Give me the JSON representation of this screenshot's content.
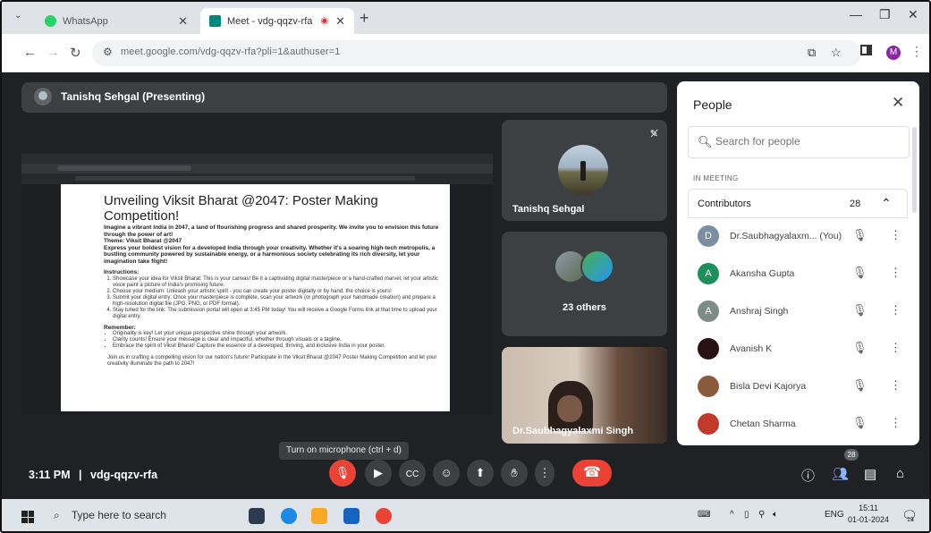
{
  "browser": {
    "tabs": [
      {
        "title": "WhatsApp",
        "active": false
      },
      {
        "title": "Meet - vdg-qqzv-rfa",
        "active": true
      }
    ],
    "url": "meet.google.com/vdg-qqzv-rfa?pli=1&authuser=1",
    "profile_initial": "M"
  },
  "meet": {
    "presenter_label": "Tanishq Sehgal (Presenting)",
    "time": "3:11 PM",
    "separator": "|",
    "meeting_code": "vdg-qqzv-rfa",
    "tooltip": "Turn on microphone (ctrl + d)",
    "participant_badge": "28",
    "tiles": [
      {
        "name": "Tanishq Sehgal"
      },
      {
        "name": "23 others"
      },
      {
        "name": "Dr.Saubhagyalaxmi Singh"
      }
    ]
  },
  "shared_doc": {
    "title": "Unveiling Viksit Bharat @2047: Poster Making Competition!",
    "intro": "Imagine a vibrant India in 2047, a land of flourishing progress and shared prosperity. We invite you to envision this future through the power of art!",
    "theme": "Theme: Viksit Bharat @2047",
    "theme_desc": "Express your boldest vision for a developed India through your creativity. Whether it's a soaring high-tech metropolis, a bustling community powered by sustainable energy, or a harmonious society celebrating its rich diversity, let your imagination take flight!",
    "instructions_heading": "Instructions:",
    "instructions": [
      "Showcase your idea for Viksit Bharat: This is your canvas! Be it a captivating digital masterpiece or a hand-crafted marvel, let your artistic voice paint a picture of India's promising future.",
      "Choose your medium: Unleash your artistic spirit - you can create your poster digitally or by hand, the choice is yours!",
      "Submit your digital entry: Once your masterpiece is complete, scan your artwork (or photograph your handmade creation) and prepare a high-resolution digital file (JPG, PNG, or PDF format).",
      "Stay tuned for the link: The submission portal will open at 3:45 PM today! You will receive a Google Forms link at that time to upload your digital entry."
    ],
    "remember_heading": "Remember:",
    "remember": [
      "Originality is key! Let your unique perspective shine through your artwork.",
      "Clarity counts! Ensure your message is clear and impactful, whether through visuals or a tagline.",
      "Embrace the spirit of Viksit Bharat! Capture the essence of a developed, thriving, and inclusive India in your poster."
    ],
    "closing": "Join us in crafting a compelling vision for our nation's future! Participate in the Viksit Bharat @2047 Poster Making Competition and let your creativity illuminate the path to 2047!"
  },
  "people_panel": {
    "title": "People",
    "search_placeholder": "Search for people",
    "section_label": "IN MEETING",
    "group_label": "Contributors",
    "group_count": "28",
    "participants": [
      {
        "initial": "D",
        "name": "Dr.Saubhagyalaxm... (You)",
        "color": "#7b8fa1"
      },
      {
        "initial": "A",
        "name": "Akansha Gupta",
        "color": "#1e8e5a"
      },
      {
        "initial": "A",
        "name": "Anshraj Singh",
        "color": "#7d8c86"
      },
      {
        "initial": "",
        "name": "Avanish K",
        "color": "#2a1212"
      },
      {
        "initial": "",
        "name": "Bisla Devi Kajorya",
        "color": "#8a5a3c"
      },
      {
        "initial": "",
        "name": "Chetan Sharma",
        "color": "#c0392b"
      }
    ]
  },
  "taskbar": {
    "search_placeholder": "Type here to search",
    "lang": "ENG",
    "clock_time": "15:11",
    "clock_date": "01-01-2024",
    "notif_count": "13"
  },
  "colors": {
    "meet_bg": "#202124",
    "tile_bg": "#3c4043",
    "danger": "#ea4335",
    "profile": "#8e24aa"
  }
}
